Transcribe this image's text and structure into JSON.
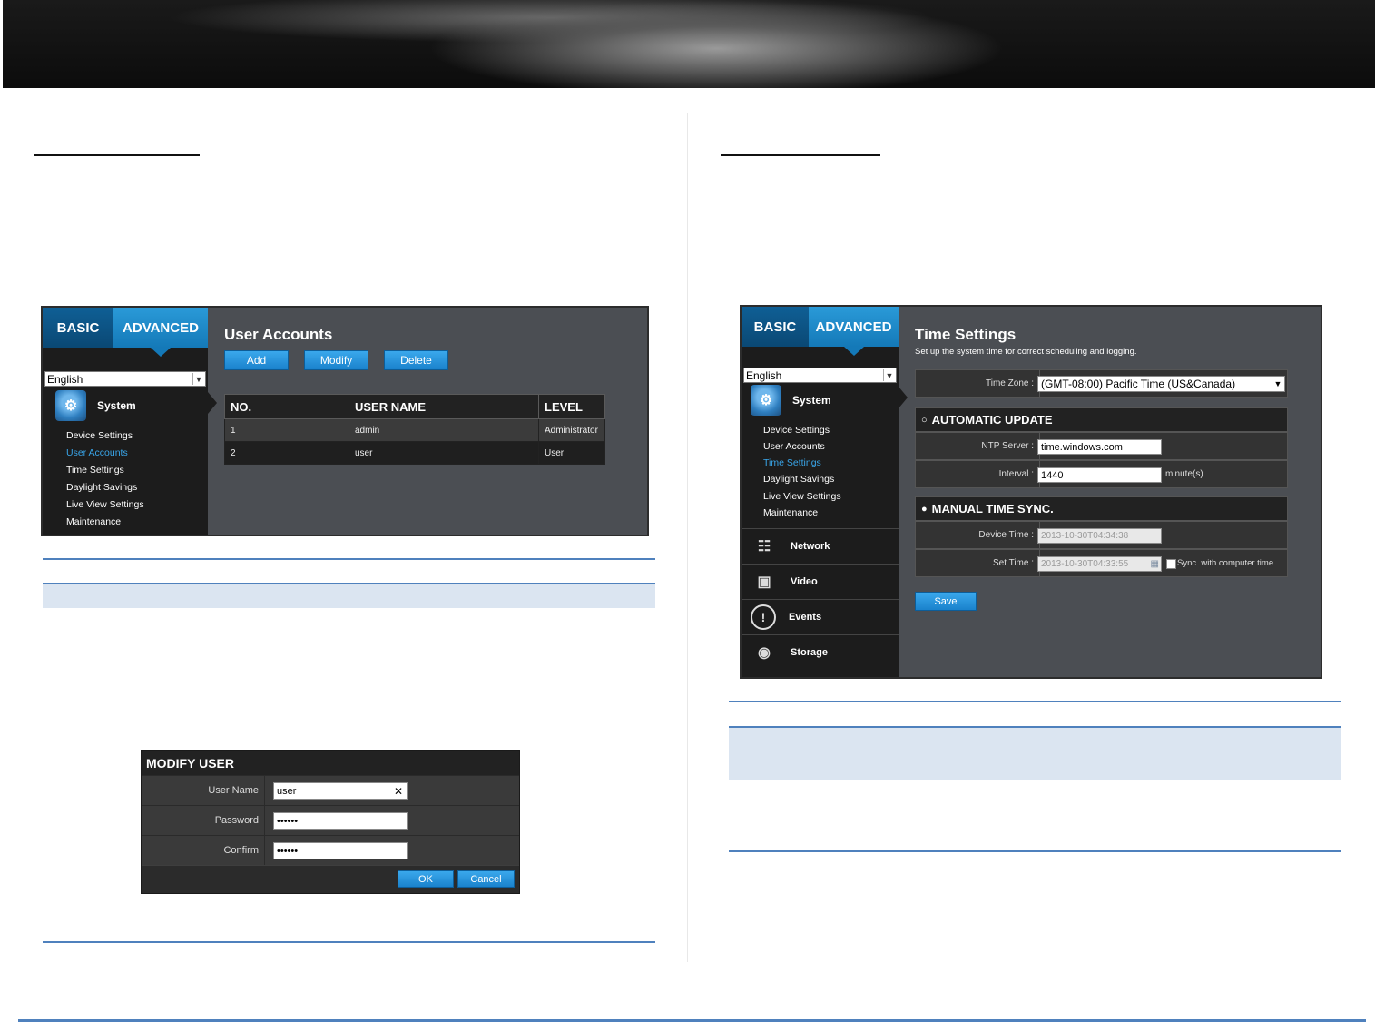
{
  "user_accounts_panel": {
    "tabs": {
      "basic": "BASIC",
      "advanced": "ADVANCED"
    },
    "language": "English",
    "system_label": "System",
    "menu": [
      "Device Settings",
      "User Accounts",
      "Time Settings",
      "Daylight Savings",
      "Live View Settings",
      "Maintenance"
    ],
    "active_menu": "User Accounts",
    "title": "User Accounts",
    "buttons": {
      "add": "Add",
      "modify": "Modify",
      "delete": "Delete"
    },
    "table": {
      "headers": [
        "NO.",
        "USER NAME",
        "LEVEL"
      ],
      "rows": [
        [
          "1",
          "admin",
          "Administrator"
        ],
        [
          "2",
          "user",
          "User"
        ]
      ]
    }
  },
  "modify_user_dialog": {
    "title": "MODIFY USER",
    "fields": {
      "user_name_label": "User Name",
      "user_name_value": "user",
      "password_label": "Password",
      "password_value": "••••••",
      "confirm_label": "Confirm",
      "confirm_value": "••••••"
    },
    "clear_glyph": "✕",
    "buttons": {
      "ok": "OK",
      "cancel": "Cancel"
    }
  },
  "time_settings_panel": {
    "tabs": {
      "basic": "BASIC",
      "advanced": "ADVANCED"
    },
    "language": "English",
    "system_label": "System",
    "menu": [
      "Device Settings",
      "User Accounts",
      "Time Settings",
      "Daylight Savings",
      "Live View Settings",
      "Maintenance"
    ],
    "active_menu": "Time Settings",
    "nav_sections": [
      "Network",
      "Video",
      "Events",
      "Storage"
    ],
    "title": "Time Settings",
    "subtitle": "Set up the system time for correct scheduling and logging.",
    "time_zone_label": "Time Zone :",
    "time_zone_value": "(GMT-08:00) Pacific Time (US&Canada)",
    "automatic_update": {
      "heading": "AUTOMATIC UPDATE",
      "ntp_label": "NTP Server :",
      "ntp_value": "time.windows.com",
      "interval_label": "Interval :",
      "interval_value": "1440",
      "interval_unit": "minute(s)"
    },
    "manual_sync": {
      "heading": "MANUAL TIME SYNC.",
      "device_time_label": "Device Time :",
      "device_time_value": "2013-10-30T04:34:38",
      "set_time_label": "Set Time :",
      "set_time_value": "2013-10-30T04:33:55",
      "sync_checkbox_label": "Sync. with computer time"
    },
    "save_label": "Save"
  },
  "colors": {
    "accent_blue": "#1a82cc",
    "active_menu_text": "#39a6ea",
    "rule_blue": "#4f81bd",
    "shade_blue": "#dbe5f1"
  }
}
